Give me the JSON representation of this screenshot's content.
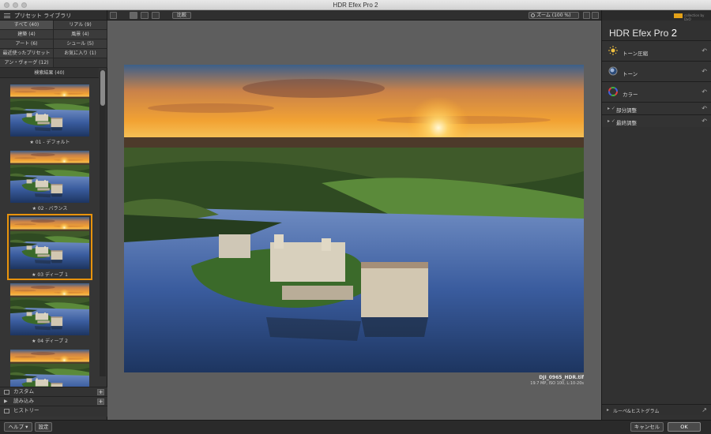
{
  "window": {
    "title": "HDR Efex Pro 2"
  },
  "library": {
    "title": "プリセット ライブラリ",
    "categories": [
      {
        "label": "すべて (40)",
        "selected": true
      },
      {
        "label": "リアル (9)",
        "selected": false
      },
      {
        "label": "建築 (4)",
        "selected": false
      },
      {
        "label": "風景 (4)",
        "selected": false
      },
      {
        "label": "アート (6)",
        "selected": false
      },
      {
        "label": "シュール (5)",
        "selected": false
      },
      {
        "label": "最近使ったプリセット",
        "selected": false
      },
      {
        "label": "お気に入り (1)",
        "selected": false
      },
      {
        "label": "アン・ヴォーグ (12)",
        "selected": false
      }
    ],
    "results_label": "検索結果 (40)",
    "presets": [
      {
        "label": "★ 01 - デフォルト",
        "selected": false
      },
      {
        "label": "★ 02 - バランス",
        "selected": false
      },
      {
        "label": "★ 03 ディープ 1",
        "selected": true
      },
      {
        "label": "★ 04 ディープ 2",
        "selected": false
      },
      {
        "label": "",
        "selected": false
      }
    ],
    "footer": {
      "custom": "カスタム",
      "import": "読み込み",
      "history": "ヒストリー"
    }
  },
  "toolbar": {
    "compare": "比較",
    "zoom": "ズーム (100 %)"
  },
  "image": {
    "filename": "DJI_0965_HDR.tif",
    "meta": "19.7 MP, ISO 100, L:10-20s"
  },
  "right_panel": {
    "brand_sub": "collection by DxO",
    "title_main": "HDR Efex Pro",
    "title_version": "2",
    "sections": [
      {
        "label": "トーン圧縮",
        "icon": "sun-icon"
      },
      {
        "label": "トーン",
        "icon": "tone-icon"
      },
      {
        "label": "カラー",
        "icon": "color-wheel-icon"
      }
    ],
    "subsections": [
      {
        "label": "部分調整"
      },
      {
        "label": "最終調整"
      }
    ],
    "loupe": "ルーペ&ヒストグラム"
  },
  "bottom": {
    "help": "ヘルプ",
    "settings": "設定",
    "cancel": "キャンセル",
    "ok": "OK"
  },
  "colors": {
    "accent": "#e8930c",
    "panel": "#353535",
    "canvas": "#5e5e5e"
  }
}
